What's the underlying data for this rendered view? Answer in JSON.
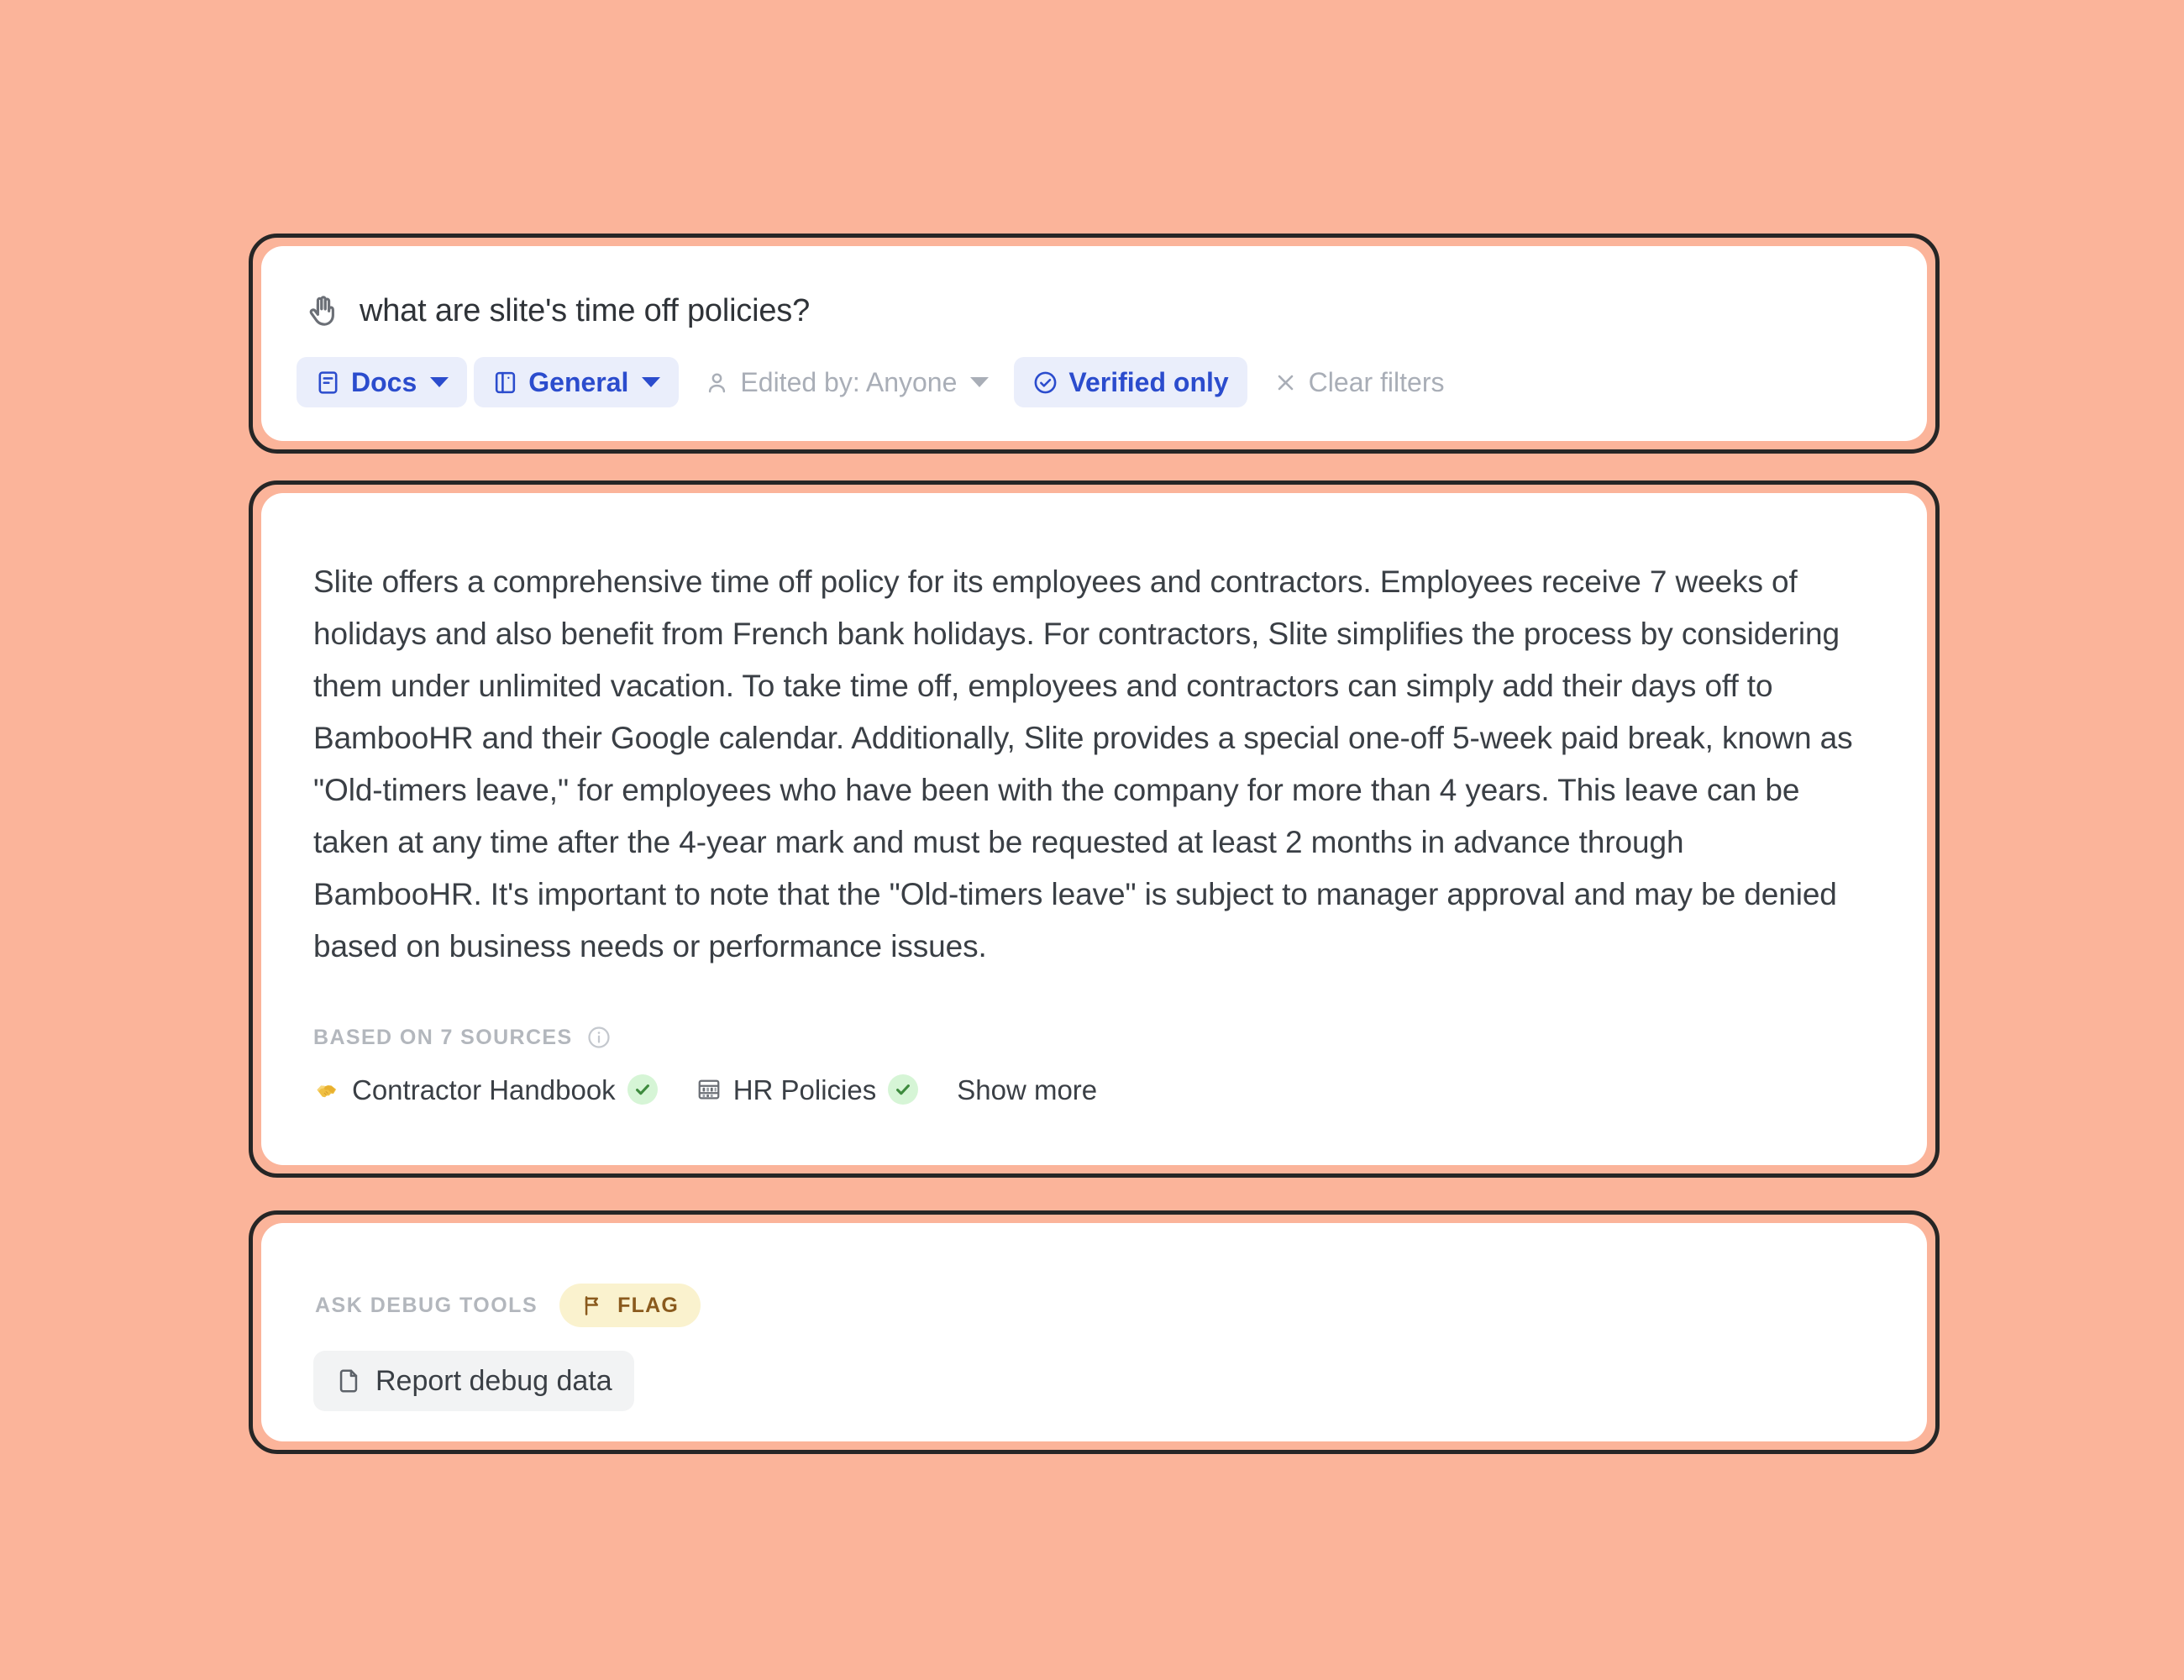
{
  "theme": {
    "background": "#fbb49a",
    "card_outline": "#262626",
    "card_surface": "#ffffff",
    "accent_blue": "#2b4ccd",
    "accent_blue_bg": "#eaeefb",
    "muted_text": "#a9aeb7",
    "body_text": "#3a3f45",
    "flag_bg": "#faf2ce",
    "flag_fg": "#8a5a1d",
    "verified_bg": "#d6f5d6",
    "verified_fg": "#3e8b3e"
  },
  "query_card": {
    "icon": "raised-hand-icon",
    "query": "what are slite's time off policies?",
    "filters": [
      {
        "id": "docs",
        "label": "Docs",
        "icon": "document-icon",
        "state": "active",
        "has_caret": true
      },
      {
        "id": "general",
        "label": "General",
        "icon": "panel-icon",
        "state": "active",
        "has_caret": true
      },
      {
        "id": "edited_by",
        "label": "Edited by: Anyone",
        "icon": "person-icon",
        "state": "muted",
        "has_caret": true
      },
      {
        "id": "verified_only",
        "label": "Verified only",
        "icon": "circle-check-icon",
        "state": "active",
        "has_caret": false
      },
      {
        "id": "clear_filters",
        "label": "Clear filters",
        "icon": "close-icon",
        "state": "muted",
        "has_caret": false
      }
    ]
  },
  "answer_card": {
    "answer": "Slite offers a comprehensive time off policy for its employees and contractors. Employees receive 7 weeks of holidays and also benefit from French bank holidays. For contractors, Slite simplifies the process by considering them under unlimited vacation. To take time off, employees and contractors can simply add their days off to BambooHR and their Google calendar. Additionally, Slite provides a special one-off 5-week paid break, known as \"Old-timers leave,\" for employees who have been with the company for more than 4 years. This leave can be taken at any time after the 4-year mark and must be requested at least 2 months in advance through BambooHR. It's important to note that the \"Old-timers leave\" is subject to manager approval and may be denied based on business needs or performance issues.",
    "sources_label": "BASED ON 7 SOURCES",
    "sources_info_icon": "info-icon",
    "sources_count": 7,
    "sources": [
      {
        "emoji": "handshake-emoji",
        "label": "Contractor Handbook",
        "verified": true
      },
      {
        "emoji": "abacus-emoji",
        "label": "HR Policies",
        "verified": true
      }
    ],
    "show_more_label": "Show more"
  },
  "debug_card": {
    "label": "ASK DEBUG TOOLS",
    "flag_badge": {
      "label": "FLAG",
      "icon": "flag-icon"
    },
    "report_button": {
      "label": "Report debug data",
      "icon": "file-icon"
    }
  }
}
